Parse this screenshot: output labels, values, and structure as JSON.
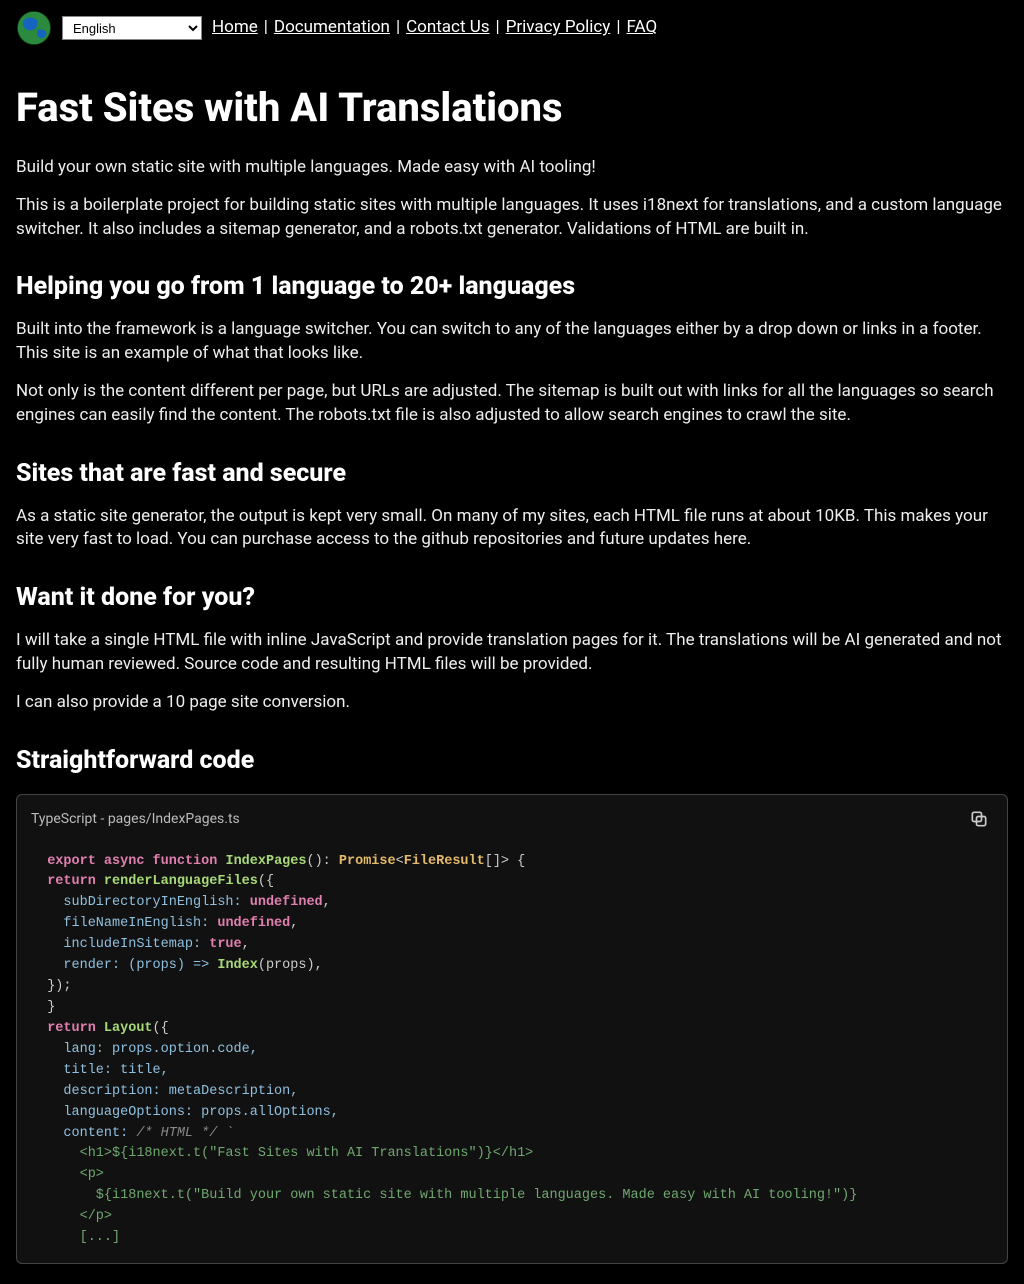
{
  "header": {
    "lang_selected": "English",
    "nav": {
      "home": "Home",
      "documentation": "Documentation",
      "contact": "Contact Us",
      "privacy": "Privacy Policy",
      "faq": "FAQ"
    }
  },
  "main": {
    "h1": "Fast Sites with AI Translations",
    "p1": "Build your own static site with multiple languages. Made easy with AI tooling!",
    "p2": "This is a boilerplate project for building static sites with multiple languages. It uses i18next for translations, and a custom language switcher. It also includes a sitemap generator, and a robots.txt generator. Validations of HTML are built in.",
    "h2a": "Helping you go from 1 language to 20+ languages",
    "p3": "Built into the framework is a language switcher. You can switch to any of the languages either by a drop down or links in a footer. This site is an example of what that looks like.",
    "p4": "Not only is the content different per page, but URLs are adjusted. The sitemap is built out with links for all the languages so search engines can easily find the content. The robots.txt file is also adjusted to allow search engines to crawl the site.",
    "h2b": "Sites that are fast and secure",
    "p5": "As a static site generator, the output is kept very small. On many of my sites, each HTML file runs at about 10KB. This makes your site very fast to load. You can purchase access to the github repositories and future updates here.",
    "h2c": "Want it done for you?",
    "p6": "I will take a single HTML file with inline JavaScript and provide translation pages for it. The translations will be AI generated and not fully human reviewed. Source code and resulting HTML files will be provided.",
    "p7": "I can also provide a 10 page site conversion.",
    "h2d": "Straightforward code"
  },
  "code": {
    "title": "TypeScript - pages/IndexPages.ts",
    "c": {
      "export": "export",
      "async": "async",
      "function": "function",
      "IndexPages": "IndexPages",
      "parenColonSp": "(): ",
      "Promise": "Promise",
      "lt": "<",
      "FileResult": "FileResult",
      "arrGtBrace": "[]> {",
      "return1": "return",
      "renderLanguageFiles": "renderLanguageFiles",
      "openCallBrace": "({",
      "subDirLabel": "    subDirectoryInEnglish: ",
      "undefined1": "undefined",
      "commaOnly": ",",
      "fileNameLabel": "    fileNameInEnglish: ",
      "undefined2": "undefined",
      "includeLabel": "    includeInSitemap: ",
      "true": "true",
      "renderLabel": "    render: (props) => ",
      "Index": "Index",
      "propsCallComma": "(props),",
      "closeCallBrace": "});",
      "closeBrace": "}",
      "return2": "return",
      "Layout": "Layout",
      "langLine": "    lang: props.option.code,",
      "titleLine": "    title: title,",
      "descLine": "    description: metaDescription,",
      "langOptLine": "    languageOptions: props.allOptions,",
      "contentLabel": "    content: ",
      "htmlCmt": "/* HTML */ `",
      "h1Line": "      <h1>${i18next.t(\"Fast Sites with AI Translations\")}</h1>",
      "pOpen": "      <p>",
      "pInner": "        ${i18next.t(\"Build your own static site with multiple languages. Made easy with AI tooling!\")}",
      "pClose": "      </p>",
      "ellipsis": "      [...]"
    }
  }
}
